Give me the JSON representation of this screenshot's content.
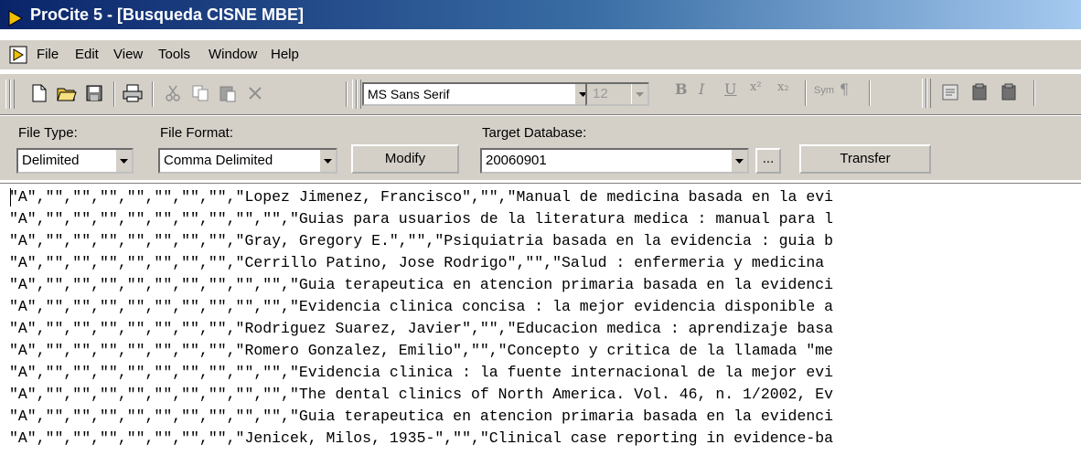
{
  "window": {
    "title": "ProCite 5 - [Busqueda CISNE MBE]"
  },
  "menu": {
    "items": [
      "File",
      "Edit",
      "View",
      "Tools",
      "Window",
      "Help"
    ]
  },
  "toolbar": {
    "font_name": "MS Sans Serif",
    "font_size": "12",
    "bold_glyph": "B",
    "italic_glyph": "I",
    "underline_glyph": "U",
    "superscript_glyph": "x²",
    "subscript_glyph": "x₂",
    "symbol_label": "Sym",
    "paragraph_glyph": "¶"
  },
  "transfer": {
    "file_type_label": "File Type:",
    "file_type_value": "Delimited",
    "file_format_label": "File Format:",
    "file_format_value": "Comma Delimited",
    "modify_label": "Modify",
    "target_db_label": "Target Database:",
    "target_db_value": "20060901",
    "browse_label": "...",
    "transfer_label": "Transfer"
  },
  "records": [
    "\"A\",\"\",\"\",\"\",\"\",\"\",\"\",\"\",\"Lopez Jimenez, Francisco\",\"\",\"Manual de medicina basada en la evi",
    "\"A\",\"\",\"\",\"\",\"\",\"\",\"\",\"\",\"\",\"\",\"Guias para usuarios de la literatura medica : manual para l",
    "\"A\",\"\",\"\",\"\",\"\",\"\",\"\",\"\",\"Gray, Gregory E.\",\"\",\"Psiquiatria basada en la evidencia : guia b",
    "\"A\",\"\",\"\",\"\",\"\",\"\",\"\",\"\",\"Cerrillo Patino, Jose Rodrigo\",\"\",\"Salud : enfermeria y medicina",
    "\"A\",\"\",\"\",\"\",\"\",\"\",\"\",\"\",\"\",\"\",\"Guia terapeutica en atencion primaria basada en la evidenci",
    "\"A\",\"\",\"\",\"\",\"\",\"\",\"\",\"\",\"\",\"\",\"Evidencia clinica concisa : la mejor evidencia disponible a",
    "\"A\",\"\",\"\",\"\",\"\",\"\",\"\",\"\",\"Rodriguez Suarez, Javier\",\"\",\"Educacion medica : aprendizaje basa",
    "\"A\",\"\",\"\",\"\",\"\",\"\",\"\",\"\",\"Romero Gonzalez, Emilio\",\"\",\"Concepto y critica de la llamada \"me",
    "\"A\",\"\",\"\",\"\",\"\",\"\",\"\",\"\",\"\",\"\",\"Evidencia clinica : la fuente internacional de la mejor evi",
    "\"A\",\"\",\"\",\"\",\"\",\"\",\"\",\"\",\"\",\"\",\"The dental clinics of North America. Vol. 46, n. 1/2002, Ev",
    "\"A\",\"\",\"\",\"\",\"\",\"\",\"\",\"\",\"\",\"\",\"Guia terapeutica en atencion primaria basada en la evidenci",
    "\"A\",\"\",\"\",\"\",\"\",\"\",\"\",\"\",\"Jenicek, Milos, 1935-\",\"\",\"Clinical case reporting in evidence-ba"
  ]
}
